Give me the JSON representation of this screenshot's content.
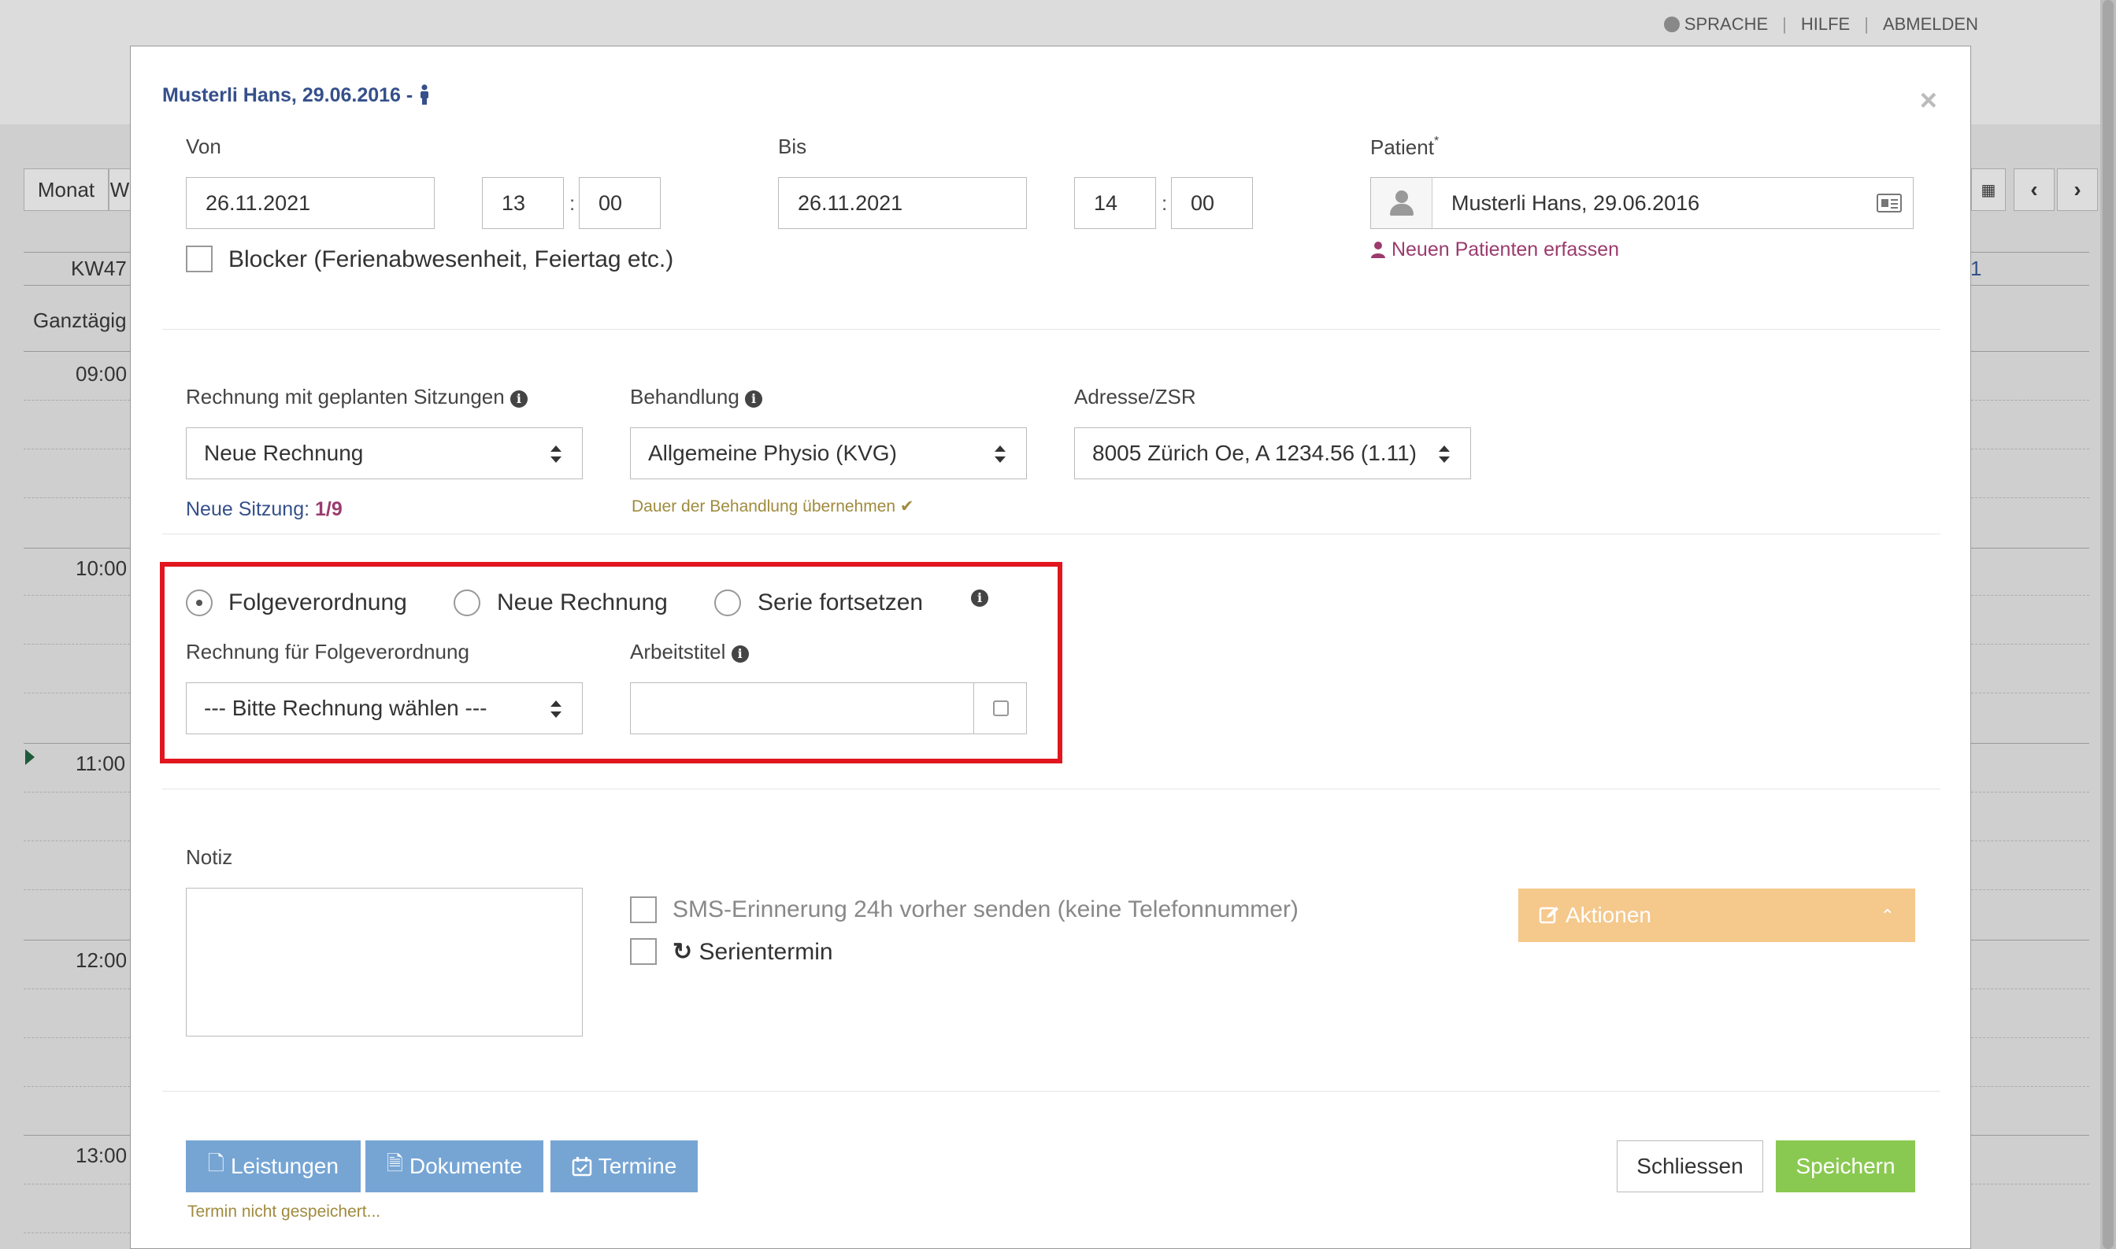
{
  "topnav": {
    "sprache": "SPRACHE",
    "hilfe": "HILFE",
    "abmelden": "ABMELDEN"
  },
  "calendar": {
    "month_button": "Monat",
    "week_button_partial": "W",
    "week_label": "KW47",
    "allday_label": "Ganztägig",
    "times": [
      "09:00",
      "10:00",
      "11:00",
      "12:00",
      "13:00"
    ],
    "right_partial": "1"
  },
  "modal": {
    "title": "Musterli Hans, 29.06.2016 -",
    "close": "×",
    "von": {
      "label": "Von",
      "date": "26.11.2021",
      "hour": "13",
      "minute": "00"
    },
    "bis": {
      "label": "Bis",
      "date": "26.11.2021",
      "hour": "14",
      "minute": "00"
    },
    "time_separator": ":",
    "patient": {
      "label": "Patient",
      "required_mark": "*",
      "value": "Musterli Hans, 29.06.2016",
      "new_patient_link": "Neuen Patienten erfassen"
    },
    "blocker": {
      "label": "Blocker (Ferienabwesenheit, Feiertag etc.)",
      "checked": false
    },
    "rechnung": {
      "label": "Rechnung mit geplanten Sitzungen",
      "value": "Neue Rechnung",
      "sitzung_label": "Neue Sitzung:",
      "sitzung_value": "1/9"
    },
    "behandlung": {
      "label": "Behandlung",
      "value": "Allgemeine Physio (KVG)",
      "hint": "Dauer der Behandlung übernehmen"
    },
    "adresse": {
      "label": "Adresse/ZSR",
      "value": "8005 Zürich Oe, A 1234.56 (1.11)"
    },
    "radio_options": [
      {
        "label": "Folgeverordnung",
        "selected": true
      },
      {
        "label": "Neue Rechnung",
        "selected": false
      },
      {
        "label": "Serie fortsetzen",
        "selected": false
      }
    ],
    "folge": {
      "label": "Rechnung für Folgeverordnung",
      "value": "--- Bitte Rechnung wählen ---"
    },
    "arbeitstitel": {
      "label": "Arbeitstitel",
      "value": ""
    },
    "notiz": {
      "label": "Notiz",
      "value": ""
    },
    "sms": {
      "label": "SMS-Erinnerung 24h vorher senden (keine Telefonnummer)",
      "checked": false
    },
    "serie": {
      "label": "Serientermin",
      "checked": false
    },
    "aktionen": "Aktionen",
    "buttons": {
      "leistungen": "Leistungen",
      "dokumente": "Dokumente",
      "termine": "Termine",
      "schliessen": "Schliessen",
      "speichern": "Speichern"
    },
    "status": "Termin nicht gespeichert..."
  },
  "colors": {
    "highlight_border": "#e1161f",
    "title_blue": "#35508a",
    "accent_purple": "#9b3b6e",
    "button_blue": "#76a5d4",
    "button_green": "#8ac951",
    "aktionen_orange": "#f5c88c"
  }
}
